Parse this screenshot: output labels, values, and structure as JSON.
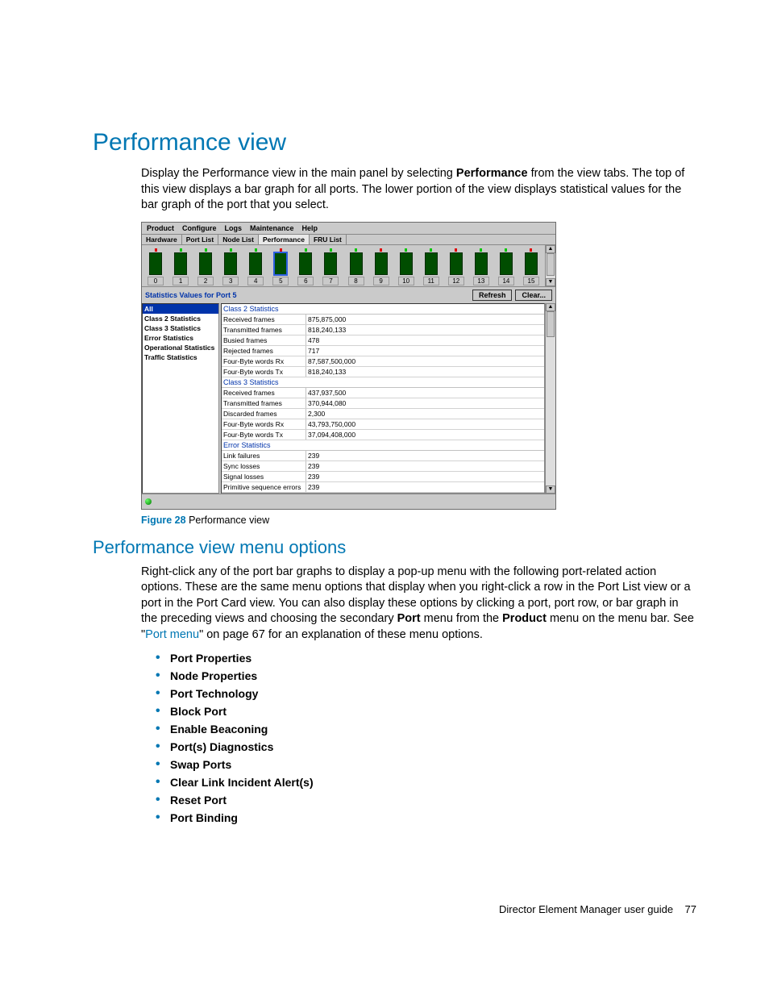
{
  "title": "Performance view",
  "intro_parts": {
    "a": "Display the Performance view in the main panel by selecting ",
    "b": "Performance",
    "c": " from the view tabs. The top of this view displays a bar graph for all ports. The lower portion of the view displays statistical values for the bar graph of the port that you select."
  },
  "figure": {
    "label": "Figure 28",
    "caption": "Performance view"
  },
  "subtitle": "Performance view menu options",
  "para2": {
    "a": "Right-click any of the port bar graphs to display a pop-up menu with the following port-related action options. These are the same menu options that display when you right-click a row in the Port List view or a port in the Port Card view. You can also display these options by clicking a port, port row, or bar graph in the preceding views and choosing the secondary ",
    "b": "Port",
    "c": " menu from the ",
    "d": "Product",
    "e": " menu on the menu bar. See \"",
    "link": "Port menu",
    "f": "\" on page 67 for an explanation of these menu options."
  },
  "menu_items": [
    "Port Properties",
    "Node Properties",
    "Port Technology",
    "Block Port",
    "Enable Beaconing",
    "Port(s) Diagnostics",
    "Swap Ports",
    "Clear Link Incident Alert(s)",
    "Reset Port",
    "Port Binding"
  ],
  "footer": {
    "text": "Director Element Manager user guide",
    "page": "77"
  },
  "app": {
    "menubar": [
      "Product",
      "Configure",
      "Logs",
      "Maintenance",
      "Help"
    ],
    "tabs": [
      "Hardware",
      "Port List",
      "Node List",
      "Performance",
      "FRU List"
    ],
    "active_tab": 3,
    "ports": [
      0,
      1,
      2,
      3,
      4,
      5,
      6,
      7,
      8,
      9,
      10,
      11,
      12,
      13,
      14,
      15
    ],
    "selected_port": 5,
    "red_led_ports": [
      0,
      5,
      9,
      12,
      15
    ],
    "stats_title": "Statistics Values for Port 5",
    "buttons": {
      "refresh": "Refresh",
      "clear": "Clear..."
    },
    "sidebar": [
      "All",
      "Class 2 Statistics",
      "Class 3 Statistics",
      "Error Statistics",
      "Operational Statistics",
      "Traffic Statistics"
    ],
    "sidebar_selected": 0,
    "groups": [
      {
        "title": "Class 2 Statistics",
        "rows": [
          [
            "Received frames",
            "875,875,000"
          ],
          [
            "Transmitted frames",
            "818,240,133"
          ],
          [
            "Busied frames",
            "478"
          ],
          [
            "Rejected frames",
            "717"
          ],
          [
            "Four-Byte words Rx",
            "87,587,500,000"
          ],
          [
            "Four-Byte words Tx",
            "818,240,133"
          ]
        ]
      },
      {
        "title": "Class 3 Statistics",
        "rows": [
          [
            "Received frames",
            "437,937,500"
          ],
          [
            "Transmitted frames",
            "370,944,080"
          ],
          [
            "Discarded frames",
            "2,300"
          ],
          [
            "Four-Byte words Rx",
            "43,793,750,000"
          ],
          [
            "Four-Byte words Tx",
            "37,094,408,000"
          ]
        ]
      },
      {
        "title": "Error Statistics",
        "rows": [
          [
            "Link failures",
            "239"
          ],
          [
            "Sync losses",
            "239"
          ],
          [
            "Signal losses",
            "239"
          ],
          [
            "Primitive sequence errors",
            "239"
          ]
        ]
      }
    ]
  }
}
